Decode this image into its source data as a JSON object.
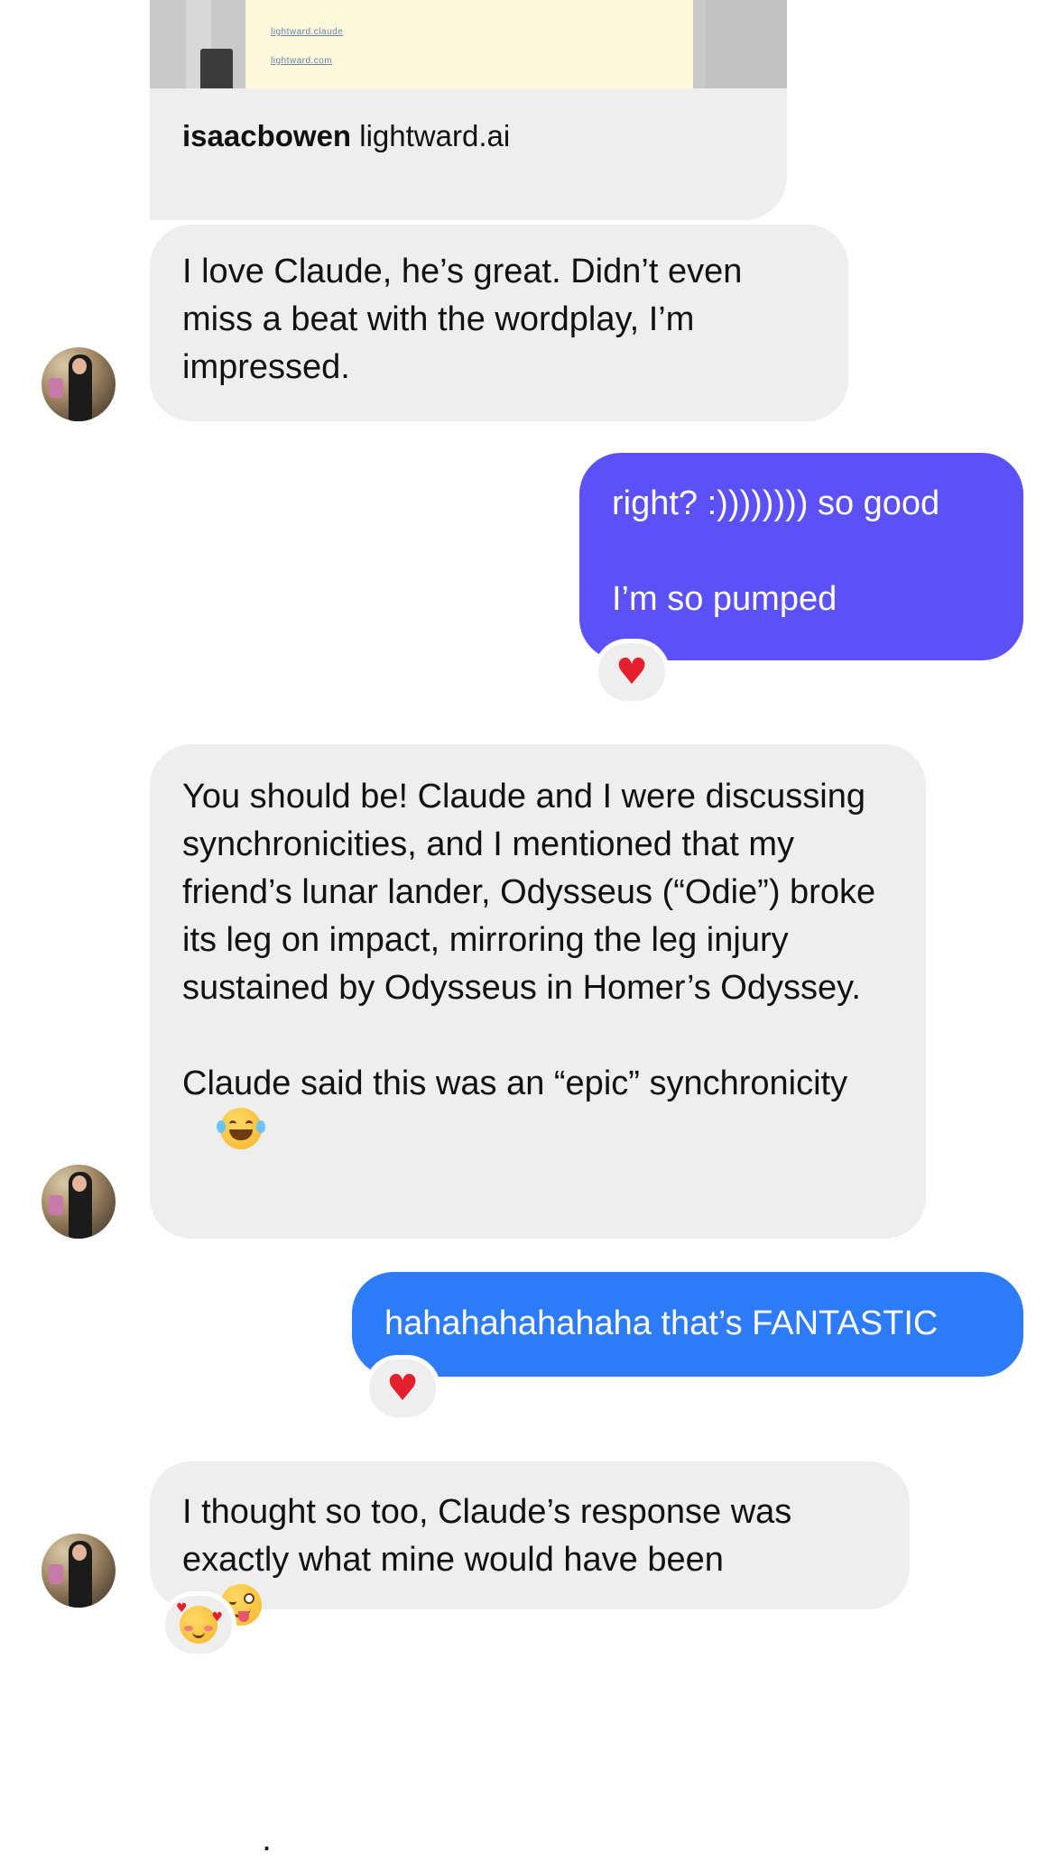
{
  "link_preview": {
    "thumb_lines": [
      "lightward.claude",
      "lightward.com"
    ],
    "username": "isaacbowen",
    "domain": "lightward.ai"
  },
  "messages": [
    {
      "id": "m1",
      "direction": "incoming",
      "paragraphs": [
        "I love Claude, he’s great. Didn’t even miss a beat with the wordplay, I’m impressed."
      ]
    },
    {
      "id": "m2",
      "direction": "outgoing",
      "bubble_color": "#5b51f7",
      "paragraphs": [
        "right? :)))))))) so good",
        "I’m so pumped"
      ],
      "reaction": "heart-icon"
    },
    {
      "id": "m3",
      "direction": "incoming",
      "paragraphs": [
        "You should be! Claude and I were discussing synchronicities, and I mentioned that my friend’s lunar lander, Odysseus (“Odie”) broke its leg on impact, mirroring the leg injury sustained by Odysseus in Homer’s Odyssey.",
        "Claude said this was an “epic” synchronicity"
      ],
      "inline_emoji": "tears-of-joy-emoji-icon"
    },
    {
      "id": "m4",
      "direction": "outgoing",
      "bubble_color": "#2d7bf6",
      "paragraphs": [
        "hahahahahahaha that’s FANTASTIC"
      ],
      "reaction": "heart-icon"
    },
    {
      "id": "m5",
      "direction": "incoming",
      "paragraphs": [
        "I thought so too, Claude’s response was exactly what mine would have been"
      ],
      "trailing_text": ".",
      "inline_emoji": "winking-tongue-emoji-icon",
      "reaction": "smiling-face-with-hearts-icon"
    }
  ],
  "colors": {
    "incoming_bubble": "#eeeeee",
    "outgoing_purple": "#5b51f7",
    "outgoing_blue": "#2d7bf6",
    "heart": "#e5202e"
  }
}
